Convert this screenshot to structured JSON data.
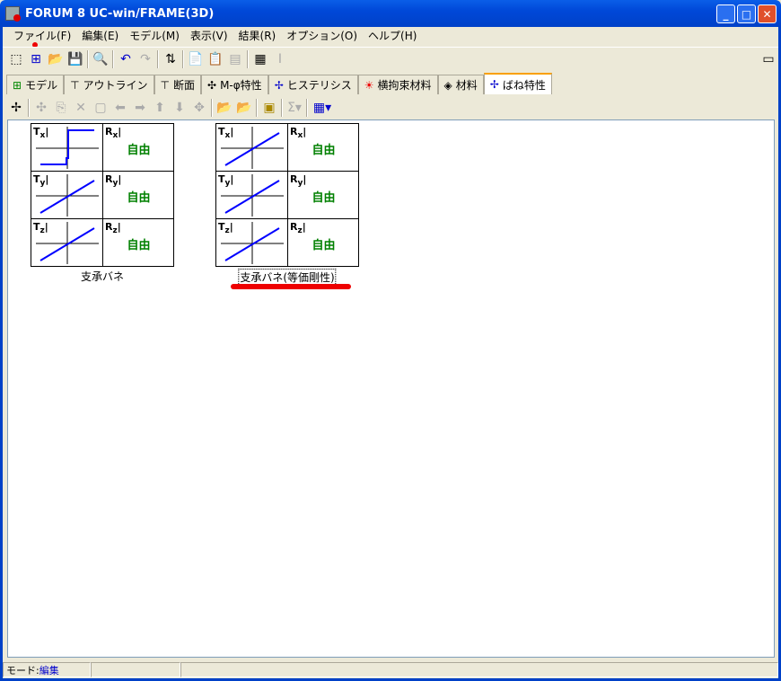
{
  "window": {
    "title": "FORUM 8  UC-win/FRAME(3D)"
  },
  "menu": [
    "ファイル(F)",
    "編集(E)",
    "モデル(M)",
    "表示(V)",
    "結果(R)",
    "オプション(O)",
    "ヘルプ(H)"
  ],
  "tabs": [
    {
      "label": "モデル",
      "icon": "model-icon"
    },
    {
      "label": "アウトライン",
      "icon": "outline-icon"
    },
    {
      "label": "断面",
      "icon": "section-icon"
    },
    {
      "label": "M-φ特性",
      "icon": "m-phi-icon"
    },
    {
      "label": "ヒステリシス",
      "icon": "hysteresis-icon"
    },
    {
      "label": "横拘束材料",
      "icon": "confinement-icon"
    },
    {
      "label": "材料",
      "icon": "material-icon"
    },
    {
      "label": "ばね特性",
      "icon": "spring-icon",
      "active": true
    }
  ],
  "springs": [
    {
      "caption": "支承バネ",
      "cells": [
        {
          "t": "T",
          "s": "x",
          "graph": "step"
        },
        {
          "t": "R",
          "s": "x",
          "text": "自由"
        },
        {
          "t": "T",
          "s": "y",
          "graph": "linear"
        },
        {
          "t": "R",
          "s": "y",
          "text": "自由"
        },
        {
          "t": "T",
          "s": "z",
          "graph": "linear"
        },
        {
          "t": "R",
          "s": "z",
          "text": "自由"
        }
      ]
    },
    {
      "caption": "支承バネ(等価剛性)",
      "selected": true,
      "cells": [
        {
          "t": "T",
          "s": "x",
          "graph": "linear"
        },
        {
          "t": "R",
          "s": "x",
          "text": "自由"
        },
        {
          "t": "T",
          "s": "y",
          "graph": "linear"
        },
        {
          "t": "R",
          "s": "y",
          "text": "自由"
        },
        {
          "t": "T",
          "s": "z",
          "graph": "linear"
        },
        {
          "t": "R",
          "s": "z",
          "text": "自由"
        }
      ]
    }
  ],
  "status": {
    "mode_label": "モード:",
    "mode_value": "編集"
  },
  "colors": {
    "free": "#008000",
    "graph": "#0000ff",
    "annotation": "#ee0000"
  }
}
